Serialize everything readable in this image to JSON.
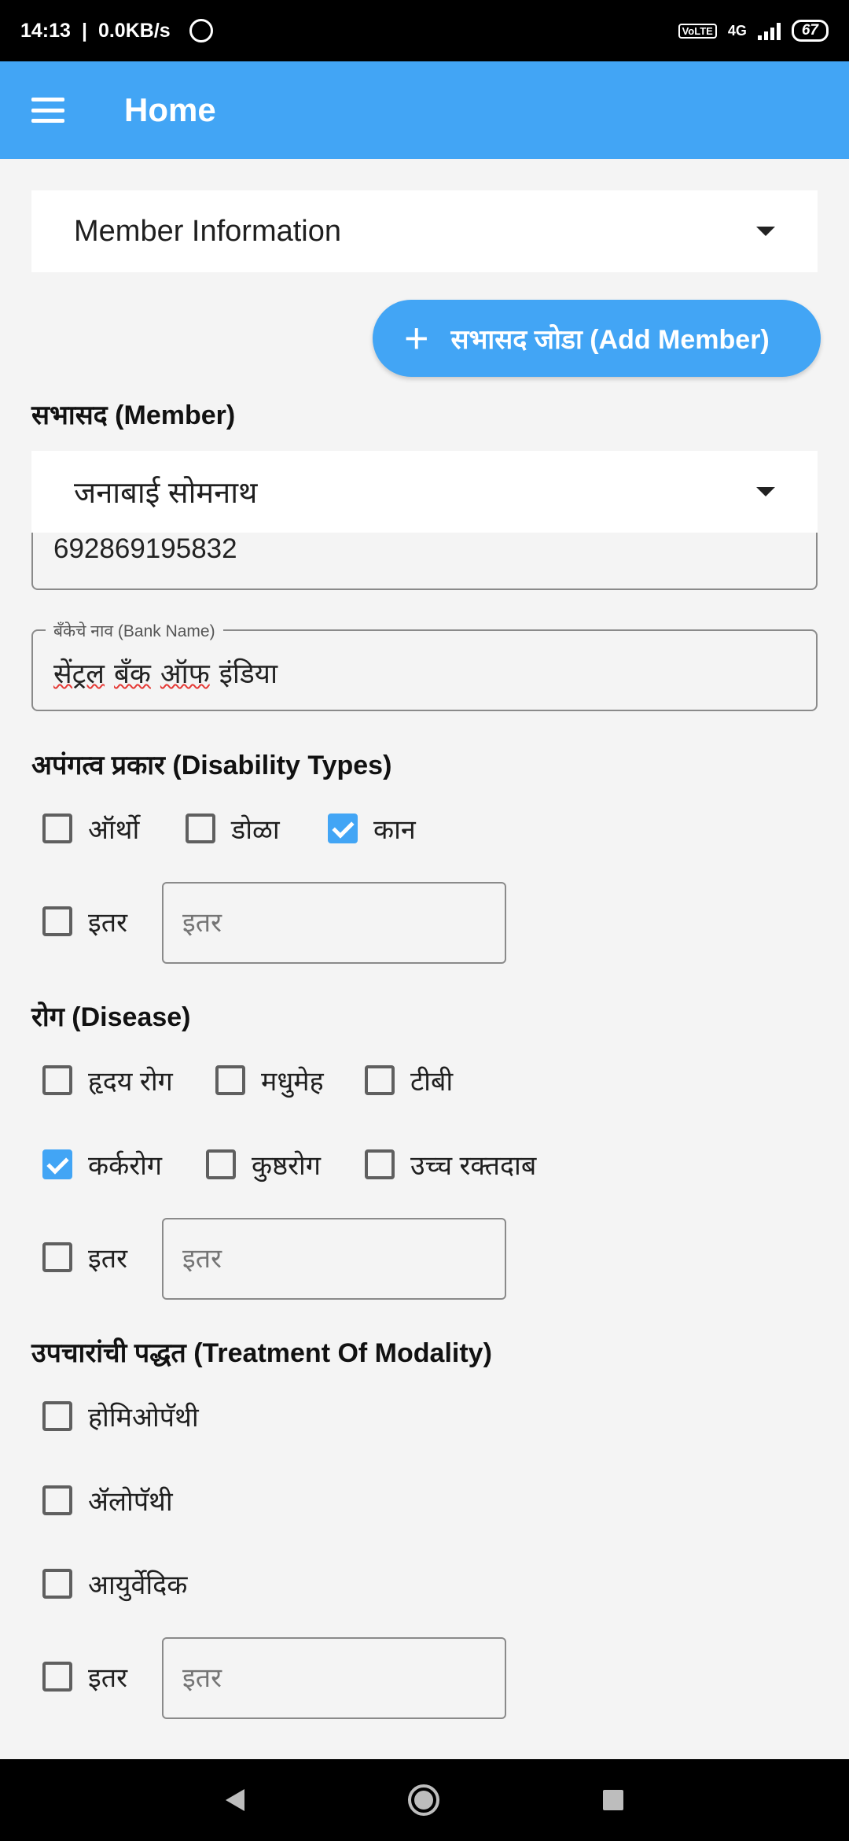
{
  "status_bar": {
    "time": "14:13",
    "speed": "0.0KB/s",
    "network": "4G",
    "volte": "VoLTE",
    "battery": "67"
  },
  "app_bar": {
    "title": "Home"
  },
  "section_dropdown": {
    "value": "Member Information"
  },
  "add_member_button": {
    "label": "सभासद जोडा (Add Member)"
  },
  "member": {
    "title": "सभासद (Member)",
    "dropdown_value": "जनाबाई सोमनाथ"
  },
  "account_field": {
    "value": "692869195832"
  },
  "bank_field": {
    "label": "बँकेचे नाव (Bank Name)",
    "words": [
      "सेंट्रल",
      "बँक",
      "ऑफ",
      "इंडिया"
    ]
  },
  "disability": {
    "title": "अपंगत्व प्रकार (Disability Types)",
    "options": [
      {
        "label": "ऑर्थो",
        "checked": false
      },
      {
        "label": "डोळा",
        "checked": false
      },
      {
        "label": "कान",
        "checked": true
      }
    ],
    "other": {
      "label": "इतर",
      "checked": false,
      "placeholder": "इतर"
    }
  },
  "disease": {
    "title": "रोग  (Disease)",
    "options": [
      {
        "label": "हृदय रोग",
        "checked": false
      },
      {
        "label": "मधुमेह",
        "checked": false
      },
      {
        "label": "टीबी",
        "checked": false
      },
      {
        "label": "कर्करोग",
        "checked": true
      },
      {
        "label": "कुष्ठरोग",
        "checked": false
      },
      {
        "label": "उच्च रक्तदाब",
        "checked": false
      }
    ],
    "other": {
      "label": "इतर",
      "checked": false,
      "placeholder": "इतर"
    }
  },
  "treatment": {
    "title": "उपचारांची पद्धत (Treatment Of Modality)",
    "options": [
      {
        "label": "होमिओपॅथी",
        "checked": false
      },
      {
        "label": "ॲलोपॅथी",
        "checked": false
      },
      {
        "label": "आयुर्वेदिक",
        "checked": false
      }
    ],
    "other": {
      "label": "इतर",
      "checked": false,
      "placeholder": "इतर"
    }
  },
  "colors": {
    "primary": "#42a5f5",
    "background": "#f4f4f4"
  },
  "icons": {
    "menu": "hamburger-icon",
    "dropdown": "caret-down-icon",
    "add": "plus-icon",
    "checkbox_checked": "check-icon"
  }
}
